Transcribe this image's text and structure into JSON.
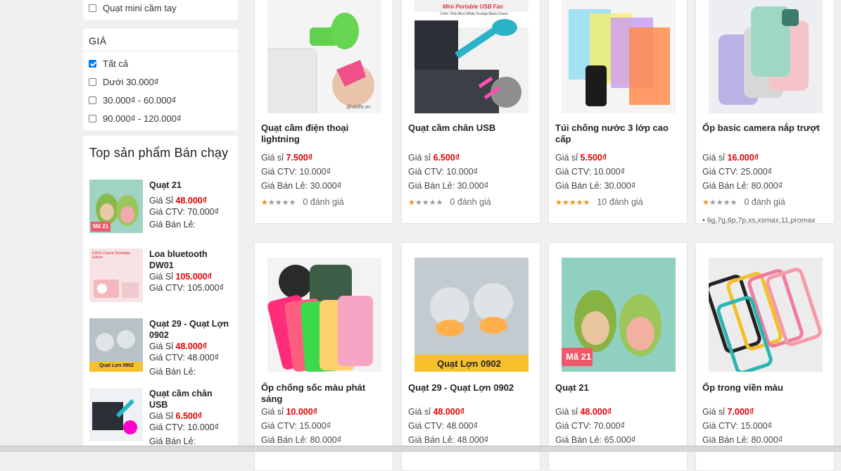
{
  "filter_top": {
    "item": "Quạt mini cầm tay"
  },
  "price_filter": {
    "title": "GIÁ",
    "options": [
      {
        "label": "Tất cả",
        "checked": true
      },
      {
        "label": "Dưới  30.000₫",
        "checked": false
      },
      {
        "label": "30.000₫ - 60.000₫",
        "checked": false
      },
      {
        "label": "90.000₫ - 120.000₫",
        "checked": false
      }
    ]
  },
  "best_sellers": {
    "title": "Top sản phẩm Bán chạy",
    "items": [
      {
        "name": "Quạt 21",
        "si_label": "Giá Sỉ",
        "si": "48.000₫",
        "ctv": "Giá CTV: 70.000₫",
        "le": "Giá Bán Lẻ:"
      },
      {
        "name": "Loa bluetooth DW01",
        "si_label": "Giá Sỉ",
        "si": "105.000₫",
        "ctv": "Giá CTV: 105.000₫",
        "le": ""
      },
      {
        "name": "Quạt 29 - Quạt Lợn 0902",
        "si_label": "Giá Sỉ",
        "si": "48.000₫",
        "ctv": "Giá CTV: 48.000₫",
        "le": "Giá Bán Lẻ:"
      },
      {
        "name": "Quạt cầm chân USB",
        "si_label": "Giá Sỉ",
        "si": "6.500₫",
        "ctv": "Giá CTV: 10.000₫",
        "le": "Giá Bán Lẻ:"
      }
    ]
  },
  "products": [
    {
      "name": "Quạt cầm điện thoại lightning",
      "si_label": "Giá sỉ",
      "si": "7.500₫",
      "ctv": "Giá CTV: 10.000₫",
      "le": "Giá Bán Lẻ: 30.000₫",
      "rating_text": "0 đánh giá",
      "stars": 1,
      "note": ""
    },
    {
      "name": "Quạt cầm chân USB",
      "si_label": "Giá sỉ",
      "si": "6.500₫",
      "ctv": "Giá CTV: 10.000₫",
      "le": "Giá Bán Lẻ: 30.000₫",
      "rating_text": "0 đánh giá",
      "stars": 1,
      "note": ""
    },
    {
      "name": "Túi chống nước 3 lớp cao cấp",
      "si_label": "Giá sỉ",
      "si": "5.500₫",
      "ctv": "Giá CTV: 10.000₫",
      "le": "Giá Bán Lẻ: 30.000₫",
      "rating_text": "10 đánh giá",
      "stars": 5,
      "note": ""
    },
    {
      "name": "Ốp basic camera nắp trượt",
      "si_label": "Giá sỉ",
      "si": "16.000₫",
      "ctv": "Giá CTV: 25.000₫",
      "le": "Giá Bán Lẻ: 80.000₫",
      "rating_text": "0 đánh giá",
      "stars": 1,
      "note": "6g,7g,6p,7p,xs,xsmax,11,promax"
    },
    {
      "name": "Ốp chống sốc màu phát sáng",
      "si_label": "Giá sỉ",
      "si": "10.000₫",
      "ctv": "Giá CTV: 15.000₫",
      "le": "Giá Bán Lẻ: 80.000₫",
      "rating_text": "",
      "stars": 0,
      "note": ""
    },
    {
      "name": "Quạt 29 - Quạt Lợn 0902",
      "si_label": "Giá sỉ",
      "si": "48.000₫",
      "ctv": "Giá CTV: 48.000₫",
      "le": "Giá Bán Lẻ: 48.000₫",
      "rating_text": "",
      "stars": 0,
      "note": ""
    },
    {
      "name": "Quạt 21",
      "si_label": "Giá sỉ",
      "si": "48.000₫",
      "ctv": "Giá CTV: 70.000₫",
      "le": "Giá Bán Lẻ: 65.000₫",
      "rating_text": "",
      "stars": 0,
      "note": ""
    },
    {
      "name": "Ốp trong viền màu",
      "si_label": "Giá sỉ",
      "si": "7.000₫",
      "ctv": "Giá CTV: 15.000₫",
      "le": "Giá Bán Lẻ: 80.000₫",
      "rating_text": "",
      "stars": 0,
      "note": ""
    }
  ],
  "images": {
    "fan_banner_text": "Mini Portable USB Fan",
    "fan_banner_sub": "Color: Pink,Blue,White,Orange,Black,Green",
    "watermark": "@wklife.vn",
    "pig_fan_label": "Quạt Lợn 0902",
    "avocado_label": "Mã 21",
    "speaker_label": "DW01 Classic Nostalgia Edition"
  },
  "colors": {
    "price_red": "#e00000",
    "star": "#f39a1f",
    "checkbox": "#0075ff"
  }
}
